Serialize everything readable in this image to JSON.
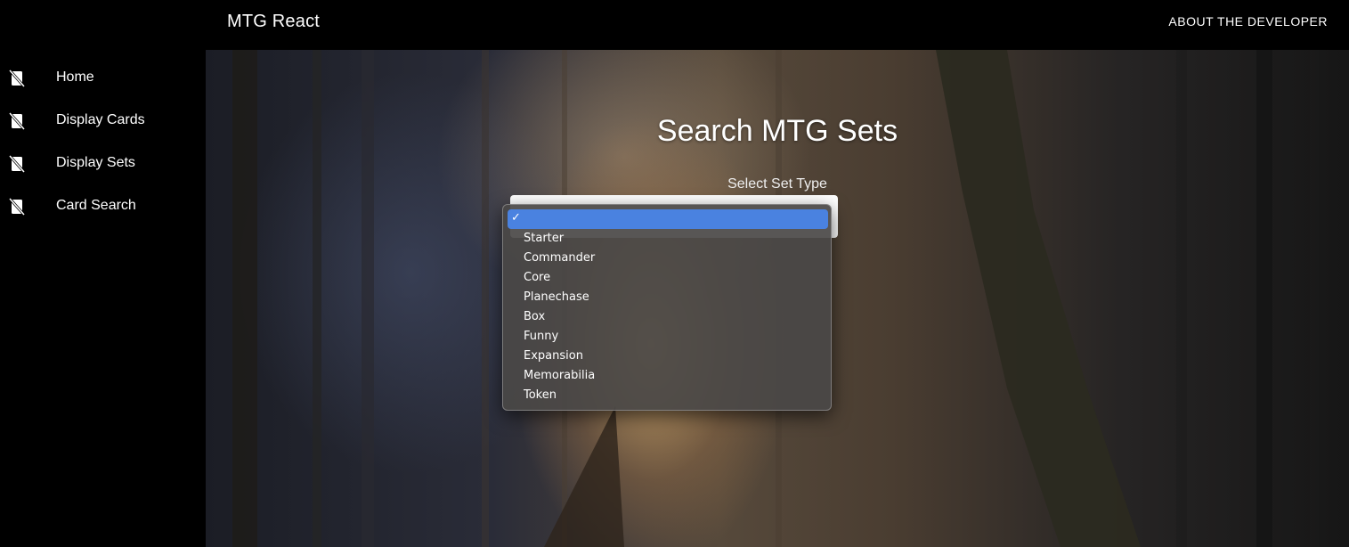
{
  "appbar": {
    "title": "MTG React",
    "about_label": "ABOUT THE DEVELOPER"
  },
  "sidebar": {
    "items": [
      {
        "label": "Home",
        "icon": "no-card-icon"
      },
      {
        "label": "Display Cards",
        "icon": "no-card-icon"
      },
      {
        "label": "Display Sets",
        "icon": "no-card-icon"
      },
      {
        "label": "Card Search",
        "icon": "no-card-icon"
      }
    ]
  },
  "main": {
    "title": "Search MTG Sets",
    "select_label": "Select Set Type",
    "select_value": "",
    "options": [
      "",
      "Starter",
      "Commander",
      "Core",
      "Planechase",
      "Box",
      "Funny",
      "Expansion",
      "Memorabilia",
      "Token"
    ],
    "selected_index": 0,
    "check_glyph": "✓"
  },
  "colors": {
    "selection": "#4a82e0",
    "menu_bg": "#4a4846"
  }
}
